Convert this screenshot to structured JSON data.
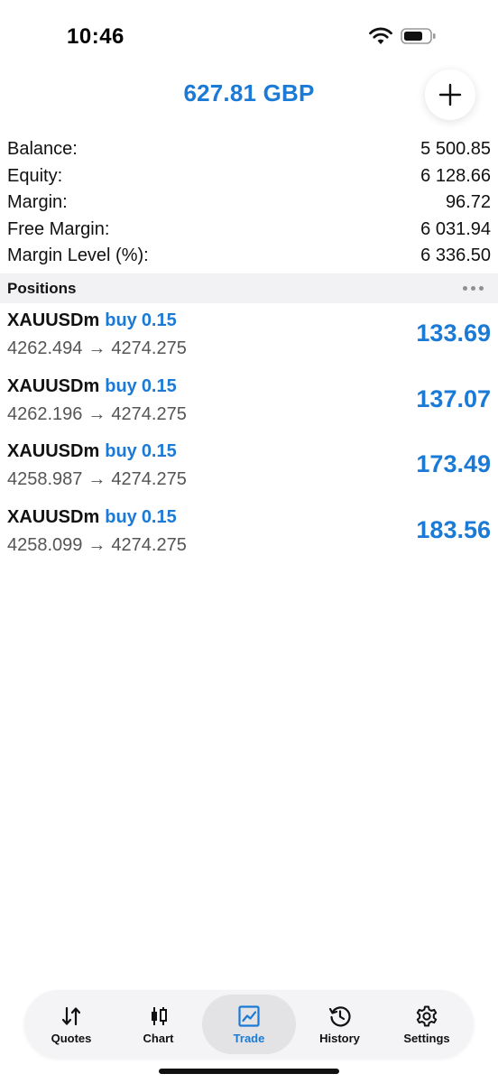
{
  "status_bar": {
    "time": "10:46",
    "icons": [
      "wifi-icon",
      "battery-icon"
    ]
  },
  "header": {
    "balance_display": "627.81 GBP",
    "add_icon": "plus-icon"
  },
  "summary": [
    {
      "label": "Balance:",
      "value": "5 500.85"
    },
    {
      "label": "Equity:",
      "value": "6 128.66"
    },
    {
      "label": "Margin:",
      "value": "96.72"
    },
    {
      "label": "Free Margin:",
      "value": "6 031.94"
    },
    {
      "label": "Margin Level (%):",
      "value": "6 336.50"
    }
  ],
  "positions": {
    "title": "Positions",
    "more_icon": "more-dots-icon",
    "items": [
      {
        "symbol": "XAUUSDm",
        "side": "buy",
        "volume": "0.15",
        "open_price": "4262.494",
        "arrow": "→",
        "current_price": "4274.275",
        "profit": "133.69"
      },
      {
        "symbol": "XAUUSDm",
        "side": "buy",
        "volume": "0.15",
        "open_price": "4262.196",
        "arrow": "→",
        "current_price": "4274.275",
        "profit": "137.07"
      },
      {
        "symbol": "XAUUSDm",
        "side": "buy",
        "volume": "0.15",
        "open_price": "4258.987",
        "arrow": "→",
        "current_price": "4274.275",
        "profit": "173.49"
      },
      {
        "symbol": "XAUUSDm",
        "side": "buy",
        "volume": "0.15",
        "open_price": "4258.099",
        "arrow": "→",
        "current_price": "4274.275",
        "profit": "183.56"
      }
    ]
  },
  "tabs": [
    {
      "label": "Quotes",
      "icon": "quotes-arrows-icon",
      "active": false
    },
    {
      "label": "Chart",
      "icon": "candlestick-icon",
      "active": false
    },
    {
      "label": "Trade",
      "icon": "trend-chart-icon",
      "active": true
    },
    {
      "label": "History",
      "icon": "history-clock-icon",
      "active": false
    },
    {
      "label": "Settings",
      "icon": "gear-icon",
      "active": false
    }
  ],
  "colors": {
    "accent": "#1a7ad6",
    "section_bg": "#f2f2f4",
    "tab_bar_bg": "#f4f4f6"
  }
}
